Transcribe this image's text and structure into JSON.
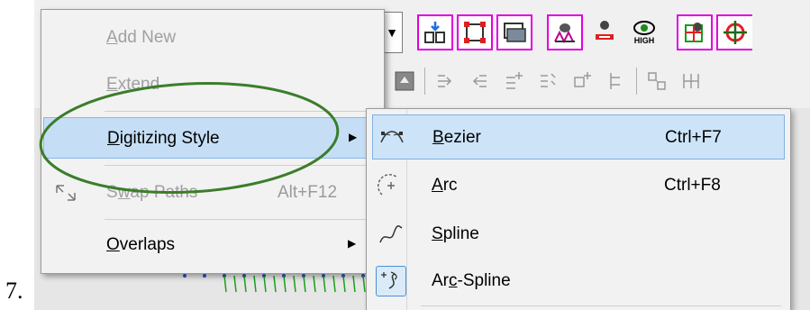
{
  "step_number": "7.",
  "context_menu": {
    "items": [
      {
        "label": "Add New",
        "ul": "A",
        "shortcut": "",
        "enabled": false
      },
      {
        "label": "Extend",
        "ul": "E",
        "shortcut": "",
        "enabled": false
      },
      {
        "label": "Digitizing Style",
        "ul": "D",
        "shortcut": "",
        "enabled": true,
        "highlighted": true,
        "submenu": true
      },
      {
        "label": "Swap Paths",
        "ul": "w",
        "shortcut": "Alt+F12",
        "enabled": false
      },
      {
        "label": "Overlaps",
        "ul": "O",
        "shortcut": "",
        "enabled": true,
        "submenu": true
      }
    ]
  },
  "submenu": {
    "items": [
      {
        "label": "Bezier",
        "ul": "B",
        "shortcut": "Ctrl+F7",
        "icon": "bezier-icon",
        "highlighted": true
      },
      {
        "label": "Arc",
        "ul": "A",
        "shortcut": "Ctrl+F8",
        "icon": "arc-icon"
      },
      {
        "label": "Spline",
        "ul": "S",
        "shortcut": "",
        "icon": "spline-icon"
      },
      {
        "label": "Arc-Spline",
        "ul": "c",
        "shortcut": "",
        "icon": "arc-spline-icon",
        "checked": true
      }
    ]
  },
  "toolbar": {
    "high_label": "HIGH"
  },
  "colors": {
    "annotation_oval": "#3b7d2a",
    "highlight": "#c5def5",
    "toolbar_border": "#e000e0"
  }
}
